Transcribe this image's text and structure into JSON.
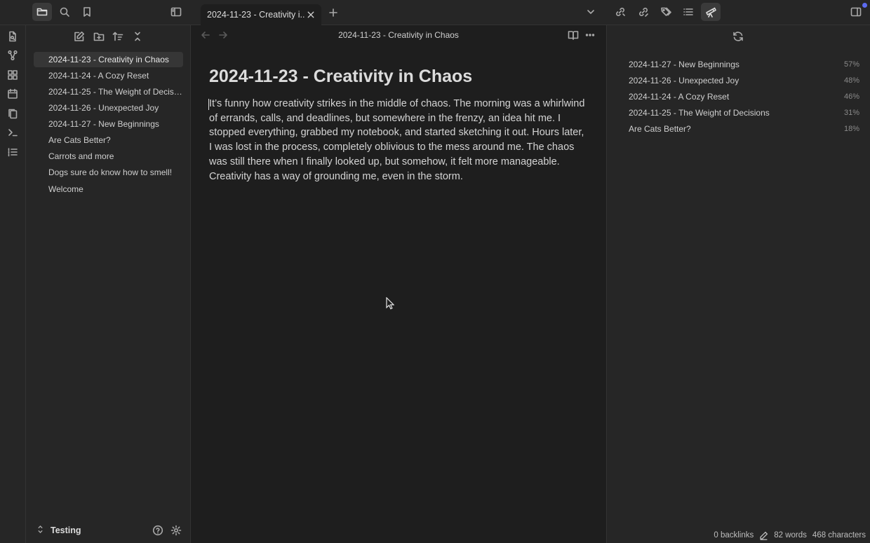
{
  "tab": {
    "title": "2024-11-23 - Creativity i..."
  },
  "editor": {
    "view_title": "2024-11-23 - Creativity in Chaos",
    "heading": "2024-11-23 - Creativity in Chaos",
    "body": "It’s funny how creativity strikes in the middle of chaos. The morning was a whirlwind of errands, calls, and deadlines, but somewhere in the frenzy, an idea hit me. I stopped everything, grabbed my notebook, and started sketching it out. Hours later, I was lost in the process, completely oblivious to the mess around me. The chaos was still there when I finally looked up, but somehow, it felt more manageable. Creativity has a way of grounding me, even in the storm."
  },
  "files": [
    {
      "label": "2024-11-23 - Creativity in Chaos"
    },
    {
      "label": "2024-11-24 - A Cozy Reset"
    },
    {
      "label": "2024-11-25 - The Weight of Decisions"
    },
    {
      "label": "2024-11-26 - Unexpected Joy"
    },
    {
      "label": "2024-11-27 - New Beginnings"
    },
    {
      "label": "Are Cats Better?"
    },
    {
      "label": "Carrots and more"
    },
    {
      "label": "Dogs sure do know how to smell!"
    },
    {
      "label": "Welcome"
    }
  ],
  "vault": {
    "name": "Testing"
  },
  "similar": [
    {
      "name": "2024-11-27 - New Beginnings",
      "pct": "57%"
    },
    {
      "name": "2024-11-26 - Unexpected Joy",
      "pct": "48%"
    },
    {
      "name": "2024-11-24 - A Cozy Reset",
      "pct": "46%"
    },
    {
      "name": "2024-11-25 - The Weight of Decisions",
      "pct": "31%"
    },
    {
      "name": "Are Cats Better?",
      "pct": "18%"
    }
  ],
  "status": {
    "backlinks": "0 backlinks",
    "words": "82 words",
    "chars": "468 characters"
  },
  "colors": {
    "accent": "#5c6bf0",
    "bg": "#1e1e1e",
    "panel": "#262626"
  }
}
